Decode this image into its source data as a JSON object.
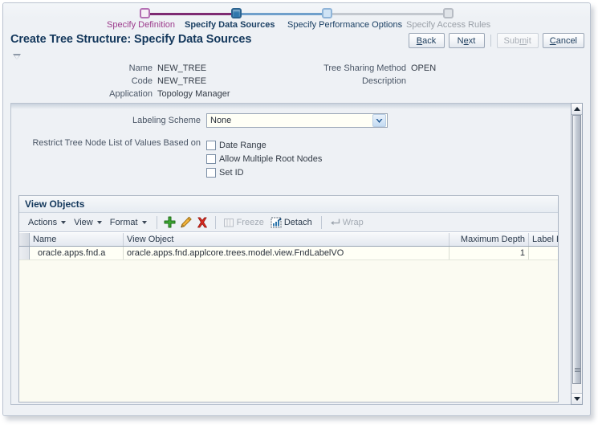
{
  "train": {
    "steps": [
      {
        "label": "Specify Definition",
        "state": "visited"
      },
      {
        "label": "Specify Data Sources",
        "state": "current"
      },
      {
        "label": "Specify Performance Options",
        "state": "enabled"
      },
      {
        "label": "Specify Access Rules",
        "state": "disabled"
      }
    ]
  },
  "header": {
    "title": "Create Tree Structure: Specify Data Sources",
    "collapse_icon": "triangle-down-icon",
    "buttons": [
      {
        "label": "Back",
        "access_key": "B",
        "disabled": false
      },
      {
        "label": "Next",
        "access_key": "e",
        "disabled": false
      },
      {
        "label": "Submit",
        "access_key": "m",
        "disabled": true
      },
      {
        "label": "Cancel",
        "access_key": "C",
        "disabled": false
      }
    ]
  },
  "summary": {
    "left": [
      {
        "label": "Name",
        "value": "NEW_TREE"
      },
      {
        "label": "Code",
        "value": "NEW_TREE"
      },
      {
        "label": "Application",
        "value": "Topology Manager"
      }
    ],
    "right": [
      {
        "label": "Tree Sharing Method",
        "value": "OPEN"
      },
      {
        "label": "Description",
        "value": ""
      }
    ]
  },
  "form": {
    "labeling_scheme": {
      "label": "Labeling Scheme",
      "value": "None",
      "options": [
        "None"
      ],
      "arrow_icon": "chevron-down-icon"
    },
    "restrict_label": "Restrict Tree Node List of Values Based on",
    "checkboxes": [
      {
        "label": "Date Range",
        "checked": false
      },
      {
        "label": "Allow Multiple Root Nodes",
        "checked": false
      },
      {
        "label": "Set ID",
        "checked": false
      }
    ]
  },
  "view_objects": {
    "title": "View Objects",
    "toolbar": {
      "menus": [
        {
          "label": "Actions"
        },
        {
          "label": "View"
        },
        {
          "label": "Format"
        }
      ],
      "icons": [
        {
          "name": "add-icon",
          "tooltip": "Add"
        },
        {
          "name": "edit-icon",
          "tooltip": "Edit"
        },
        {
          "name": "delete-icon",
          "tooltip": "Delete"
        }
      ],
      "items": [
        {
          "label": "Freeze",
          "icon": "freeze-icon",
          "disabled": true
        },
        {
          "label": "Detach",
          "icon": "detach-icon",
          "disabled": false
        },
        {
          "label": "Wrap",
          "icon": "wrap-icon",
          "disabled": true
        }
      ]
    },
    "table": {
      "columns": [
        "Name",
        "View Object",
        "Maximum Depth",
        "Label Data"
      ],
      "rows": [
        {
          "name": "oracle.apps.fnd.a",
          "view_object": "oracle.apps.fnd.applcore.trees.model.view.FndLabelVO",
          "maximum_depth": "1",
          "label_data": ""
        }
      ]
    }
  },
  "scrollbar": {
    "up_icon": "arrow-up-icon",
    "down_icon": "arrow-down-icon"
  },
  "colors": {
    "visited": "#9c3b8c",
    "current": "#2f77ad",
    "enabled": "#8fb4d8",
    "disabled": "#b7bcc4",
    "title": "#14385c",
    "panel_bg": "#eef1f5",
    "field_bg": "#fffff6"
  }
}
